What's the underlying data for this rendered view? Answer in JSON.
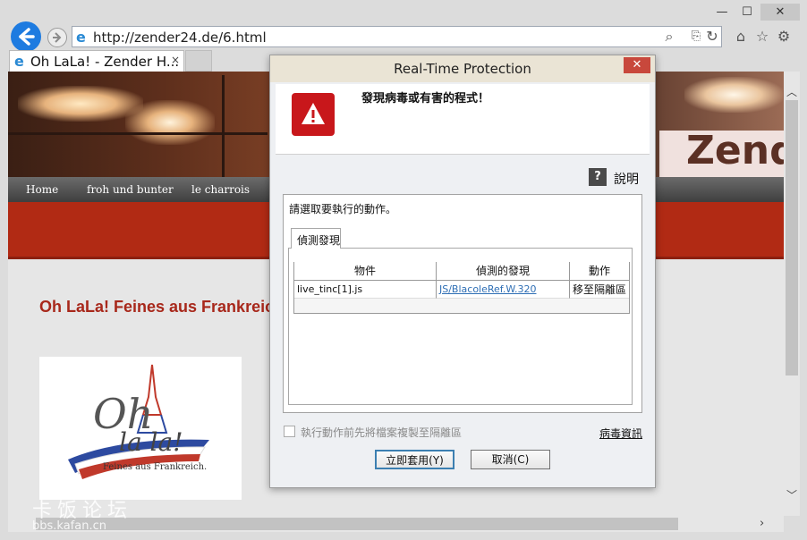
{
  "browser": {
    "url": "http://zender24.de/6.html",
    "tab_title": "Oh LaLa! - Zender H...",
    "tab_close": "×",
    "window_controls": {
      "minimize": "—",
      "maximize": "☐",
      "close": "✕"
    },
    "icons": [
      "back-arrow-icon",
      "forward-arrow-icon",
      "ie-logo-icon",
      "search-icon",
      "compat-view-icon",
      "refresh-icon",
      "home-icon",
      "favorites-star-icon",
      "settings-gear-icon"
    ]
  },
  "page": {
    "nav": [
      "Home",
      "froh und bunter",
      "le charrois"
    ],
    "banner_brand": "Zend",
    "heading": "Oh LaLa! Feines aus Frankreich",
    "logo": {
      "oh": "Oh",
      "lala": "la la!",
      "subtitle": "Feines aus Frankreich."
    },
    "watermark": {
      "cn": "卡饭论坛",
      "url": "bbs.kafan.cn"
    }
  },
  "dialog": {
    "title": "Real-Time Protection",
    "close": "✕",
    "message": "發現病毒或有害的程式！",
    "help_label": "說明",
    "help_icon_glyph": "?",
    "prompt": "請選取要執行的動作。",
    "tab_label": "偵測發現",
    "table": {
      "headers": [
        "物件",
        "偵測的發現",
        "動作"
      ],
      "rows": [
        {
          "object": "live_tinc[1].js",
          "finding": "JS/BlacoleRef.W.320",
          "action": "移至隔離區"
        }
      ]
    },
    "checkbox_label": "執行動作前先將檔案複製至隔離區",
    "checkbox_checked": false,
    "virus_info_link": "病毒資訊",
    "apply_button": "立即套用(Y)",
    "cancel_button": "取消(C)"
  }
}
